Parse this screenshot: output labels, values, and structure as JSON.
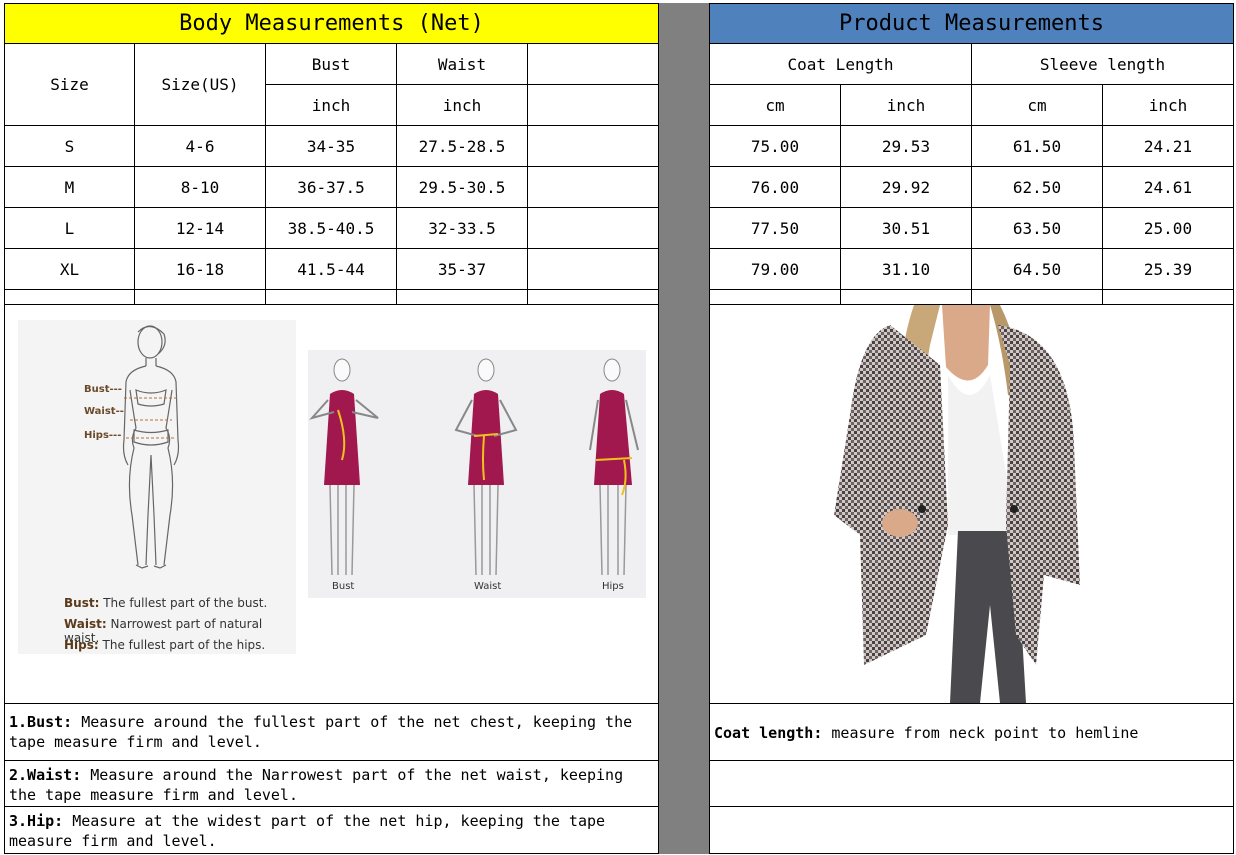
{
  "body_table": {
    "title": "Body Measurements (Net)",
    "headers": {
      "size": "Size",
      "size_us": "Size(US)",
      "bust": "Bust",
      "waist": "Waist",
      "bust_unit": "inch",
      "waist_unit": "inch"
    },
    "rows": [
      {
        "size": "S",
        "size_us": "4-6",
        "bust": "34-35",
        "waist": "27.5-28.5"
      },
      {
        "size": "M",
        "size_us": "8-10",
        "bust": "36-37.5",
        "waist": "29.5-30.5"
      },
      {
        "size": "L",
        "size_us": "12-14",
        "bust": "38.5-40.5",
        "waist": "32-33.5"
      },
      {
        "size": "XL",
        "size_us": "16-18",
        "bust": "41.5-44",
        "waist": "35-37"
      }
    ]
  },
  "product_table": {
    "title": "Product Measurements",
    "headers": {
      "coat": "Coat Length",
      "sleeve": "Sleeve length",
      "cm": "cm",
      "inch": "inch"
    },
    "rows": [
      {
        "coat_cm": "75.00",
        "coat_in": "29.53",
        "sleeve_cm": "61.50",
        "sleeve_in": "24.21"
      },
      {
        "coat_cm": "76.00",
        "coat_in": "29.92",
        "sleeve_cm": "62.50",
        "sleeve_in": "24.61"
      },
      {
        "coat_cm": "77.50",
        "coat_in": "30.51",
        "sleeve_cm": "63.50",
        "sleeve_in": "25.00"
      },
      {
        "coat_cm": "79.00",
        "coat_in": "31.10",
        "sleeve_cm": "64.50",
        "sleeve_in": "25.39"
      }
    ]
  },
  "diagram": {
    "bust_mark": "Bust---",
    "waist_mark": "Waist--",
    "hips_mark": "Hips---",
    "legend": [
      {
        "term": "Bust:",
        "desc": "The fullest part of the bust."
      },
      {
        "term": "Waist:",
        "desc": "Narrowest part of natural waist."
      },
      {
        "term": "Hips:",
        "desc": "The fullest part of the hips."
      }
    ],
    "figure_labels": [
      "Bust",
      "Waist",
      "Hips"
    ]
  },
  "notes": [
    {
      "term": "1.Bust:",
      "text": " Measure around the fullest part of the net chest, keeping the tape  measure firm and level."
    },
    {
      "term": "2.Waist:",
      "text": " Measure around the Narrowest part of the net waist, keeping the tape  measure firm and level."
    },
    {
      "term": "3.Hip:",
      "text": " Measure at the widest part of the net hip, keeping the tape measure firm and level."
    }
  ],
  "coat_note": {
    "term": "Coat length:",
    "text": " measure from neck point to hemline"
  },
  "colors": {
    "yellow": "#ffff00",
    "blue": "#4f81bd",
    "gray": "#808080",
    "dress": "#a0184e",
    "tape": "#f0c020"
  }
}
